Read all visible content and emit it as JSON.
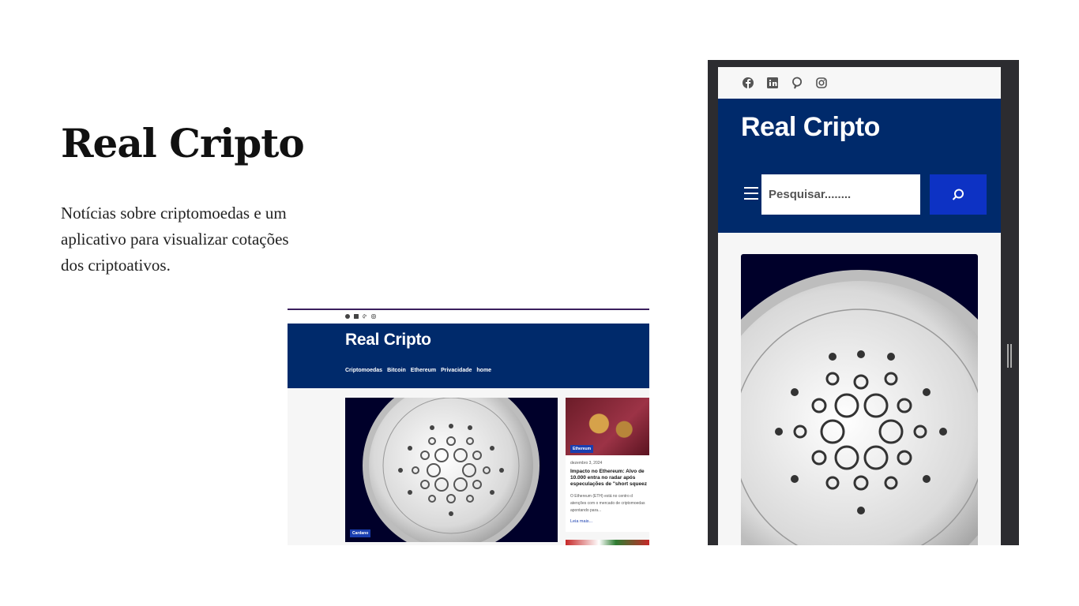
{
  "hero": {
    "title": "Real Cripto",
    "description": "Notícias sobre criptomoedas e um aplicativo para visualizar cotações dos criptoativos."
  },
  "desktop": {
    "logo": "Real Cripto",
    "nav": [
      "Criptomoedas",
      "Bitcoin",
      "Ethereum",
      "Privacidade",
      "home"
    ],
    "social_icons": [
      "facebook-icon",
      "linkedin-icon",
      "pinterest-icon",
      "instagram-icon"
    ],
    "main_card": {
      "badge": "Cardano"
    },
    "side_card": {
      "badge": "Ethereum",
      "date": "dezembro 3, 2024",
      "title": "Impacto no Ethereum: Alvo de 10.000 entra no radar após especulações de \"short squeez",
      "excerpt": "O Ethereum (ETH) está no centro d atenções com o mercado de criptomoedas apontando para...",
      "read_more": "Leia mais..."
    }
  },
  "mobile": {
    "logo": "Real Cripto",
    "social_icons": [
      "facebook-icon",
      "linkedin-icon",
      "pinterest-icon",
      "instagram-icon"
    ],
    "search": {
      "placeholder": "Pesquisar........"
    }
  },
  "colors": {
    "header_blue": "#002a6b",
    "accent_blue": "#0d32c4",
    "badge_blue": "#1a3fb0",
    "coin_bg": "#00002a"
  }
}
